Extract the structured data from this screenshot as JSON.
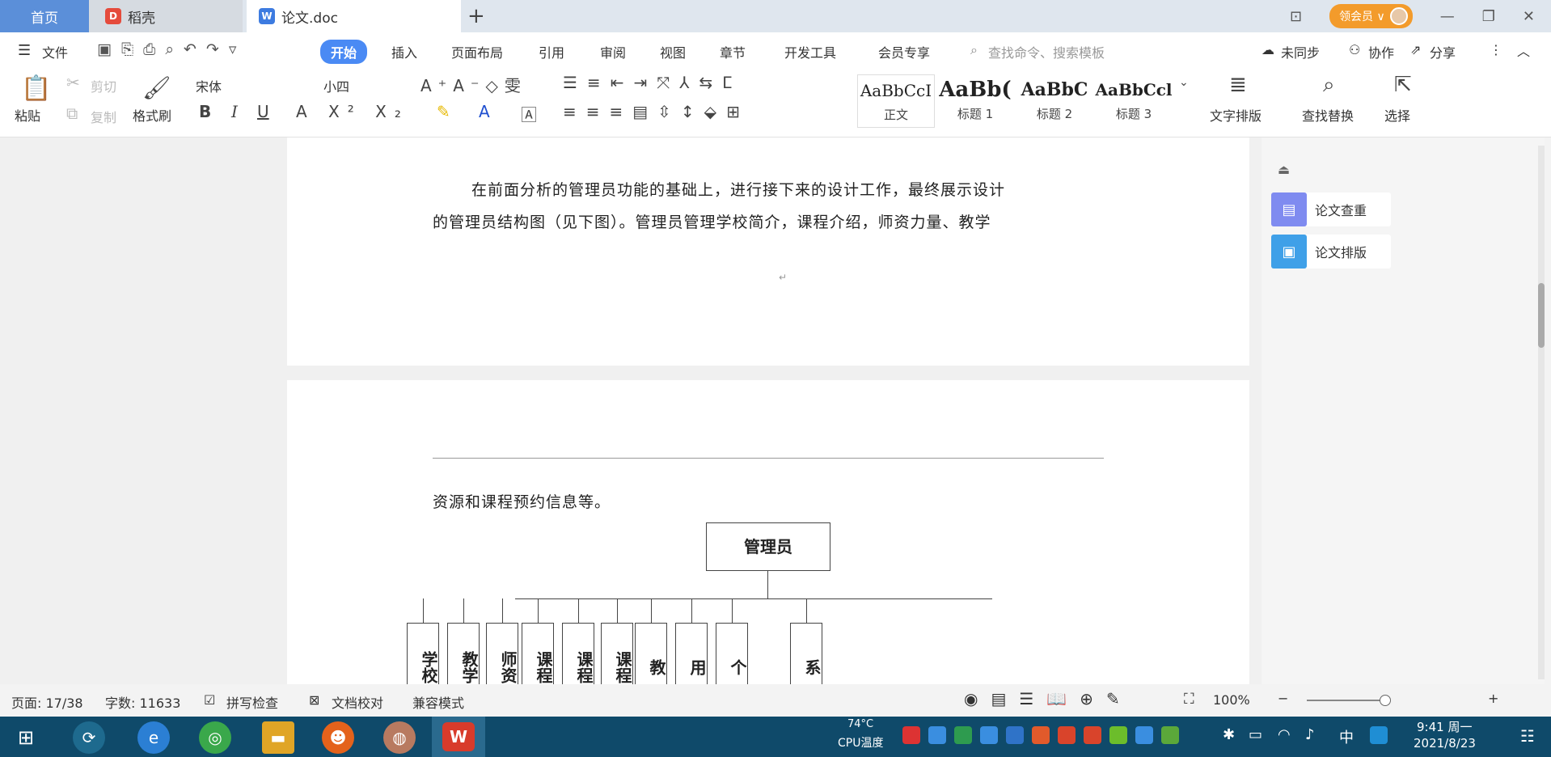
{
  "tabs": {
    "home": "首页",
    "daoke": "稻壳",
    "doc": "论文.doc",
    "plus": "+"
  },
  "vip": "领会员 ∨",
  "menu": {
    "file": "文件",
    "start": "开始",
    "insert": "插入",
    "layout": "页面布局",
    "ref": "引用",
    "review": "审阅",
    "view": "视图",
    "section": "章节",
    "dev": "开发工具",
    "member": "会员专享",
    "search_placeholder": "查找命令、搜索模板",
    "sync": "未同步",
    "collab": "协作",
    "share": "分享"
  },
  "ribbon": {
    "paste": "粘贴",
    "cut": "剪切",
    "copy": "复制",
    "format_painter": "格式刷",
    "font": "宋体",
    "size": "小四",
    "styles": [
      {
        "preview": "AaBbCcI",
        "name": "正文"
      },
      {
        "preview": "AaBb(",
        "name": "标题 1"
      },
      {
        "preview": "AaBbC",
        "name": "标题 2"
      },
      {
        "preview": "AaBbCcl",
        "name": "标题 3"
      }
    ],
    "text_layout": "文字排版",
    "find_replace": "查找替换",
    "select": "选择"
  },
  "document": {
    "page1_line1": "在前面分析的管理员功能的基础上，进行接下来的设计工作，最终展示设计",
    "page1_line2": "的管理员结构图（见下图）。管理员管理学校简介，课程介绍，师资力量、教学",
    "page2_line1": "资源和课程预约信息等。",
    "org_root": "管理员",
    "org_children": [
      "学校",
      "教学",
      "师资",
      "课程",
      "课程",
      "课程",
      "教",
      "用",
      "个",
      "系"
    ]
  },
  "side_panel": {
    "check": "论文查重",
    "format": "论文排版"
  },
  "status": {
    "page": "页面: 17/38",
    "words": "字数: 11633",
    "spell": "拼写检查",
    "proof": "文档校对",
    "compat": "兼容模式",
    "zoom": "100%"
  },
  "taskbar": {
    "cpu_temp": "74°C",
    "cpu_label": "CPU温度",
    "lang": "中",
    "time": "9:41 周一",
    "date": "2021/8/23"
  },
  "colors": {
    "accent": "#4a8af4",
    "taskbar": "#0f4a6a",
    "vip": "#f39b2b",
    "wps_red": "#d83b2b"
  }
}
